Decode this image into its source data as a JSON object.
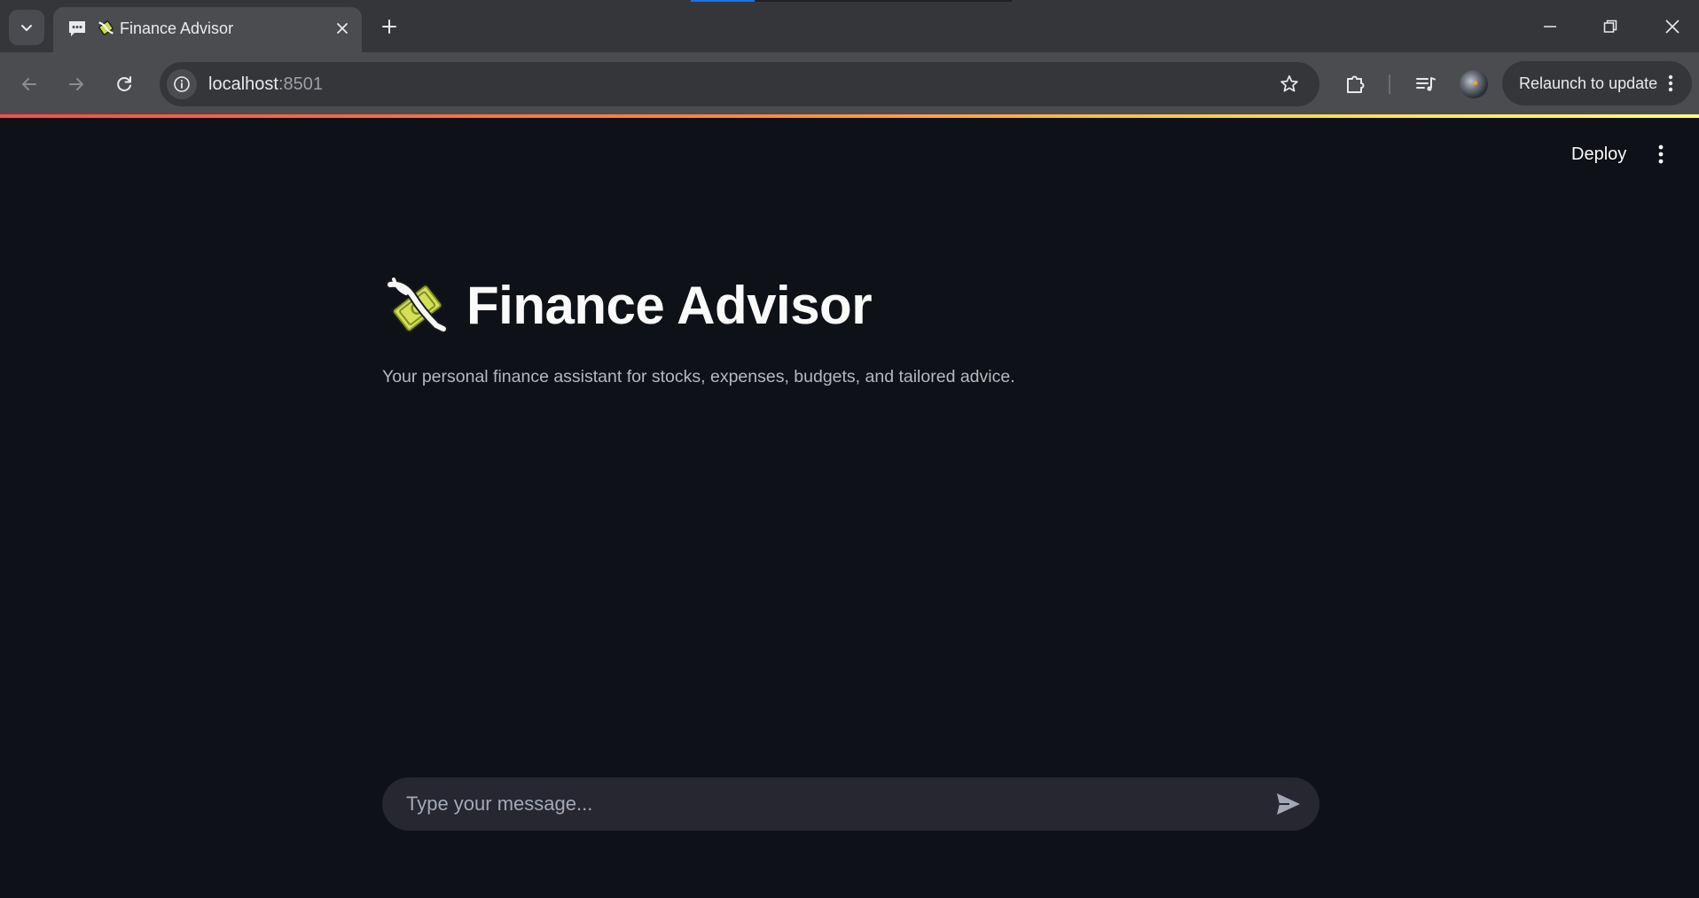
{
  "browser": {
    "tab": {
      "title": "Finance Advisor"
    },
    "address_bar": {
      "host": "localhost",
      "port": ":8501"
    },
    "relaunch_label": "Relaunch to update",
    "colors": {
      "tabstrip": "#35363a",
      "toolbar": "#4b4c50",
      "loading_accent": "#1a73e8"
    }
  },
  "app": {
    "header": {
      "deploy_label": "Deploy"
    },
    "title": "Finance Advisor",
    "title_icon": "money-with-wings-emoji",
    "subtitle": "Your personal finance assistant for stocks, expenses, budgets, and tailored advice.",
    "chat": {
      "placeholder": "Type your message..."
    },
    "colors": {
      "background": "#0e1117",
      "input": "#262730",
      "text": "#fafafa",
      "muted": "#b6b8bd"
    }
  }
}
